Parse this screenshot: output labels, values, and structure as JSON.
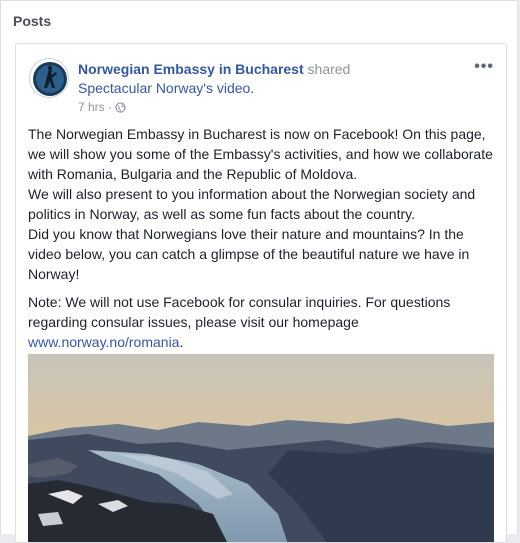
{
  "section": {
    "title": "Posts"
  },
  "post": {
    "page_name": "Norwegian Embassy in Bucharest",
    "shared_word": "shared",
    "shared_link": "Spectacular Norway's video.",
    "time": "7 hrs",
    "dot": "·",
    "more": "•••",
    "paragraph_lines": [
      "The Norwegian Embassy in Bucharest is now on Facebook! On this page, we will show you some of the Embassy's activities, and how we collaborate with Romania, Bulgaria and the Republic of Moldova.",
      "We will also present to you information about the Norwegian society and politics in Norway, as well as some fun facts about the country.",
      "Did you know that Norwegians love their nature and mountains? In the video below, you can catch a glimpse of the beautiful nature we have in Norway!"
    ],
    "note_text": "Note: We will not use Facebook for consular inquiries. For questions regarding consular issues, please visit our homepage",
    "note_link": "www.norway.no/romania",
    "note_end": "."
  },
  "colors": {
    "link": "#365899",
    "muted": "#90949c",
    "text": "#1d2129"
  },
  "icons": {
    "privacy": "globe-icon",
    "avatar": "embassy-logo",
    "options": "more-options-icon"
  }
}
